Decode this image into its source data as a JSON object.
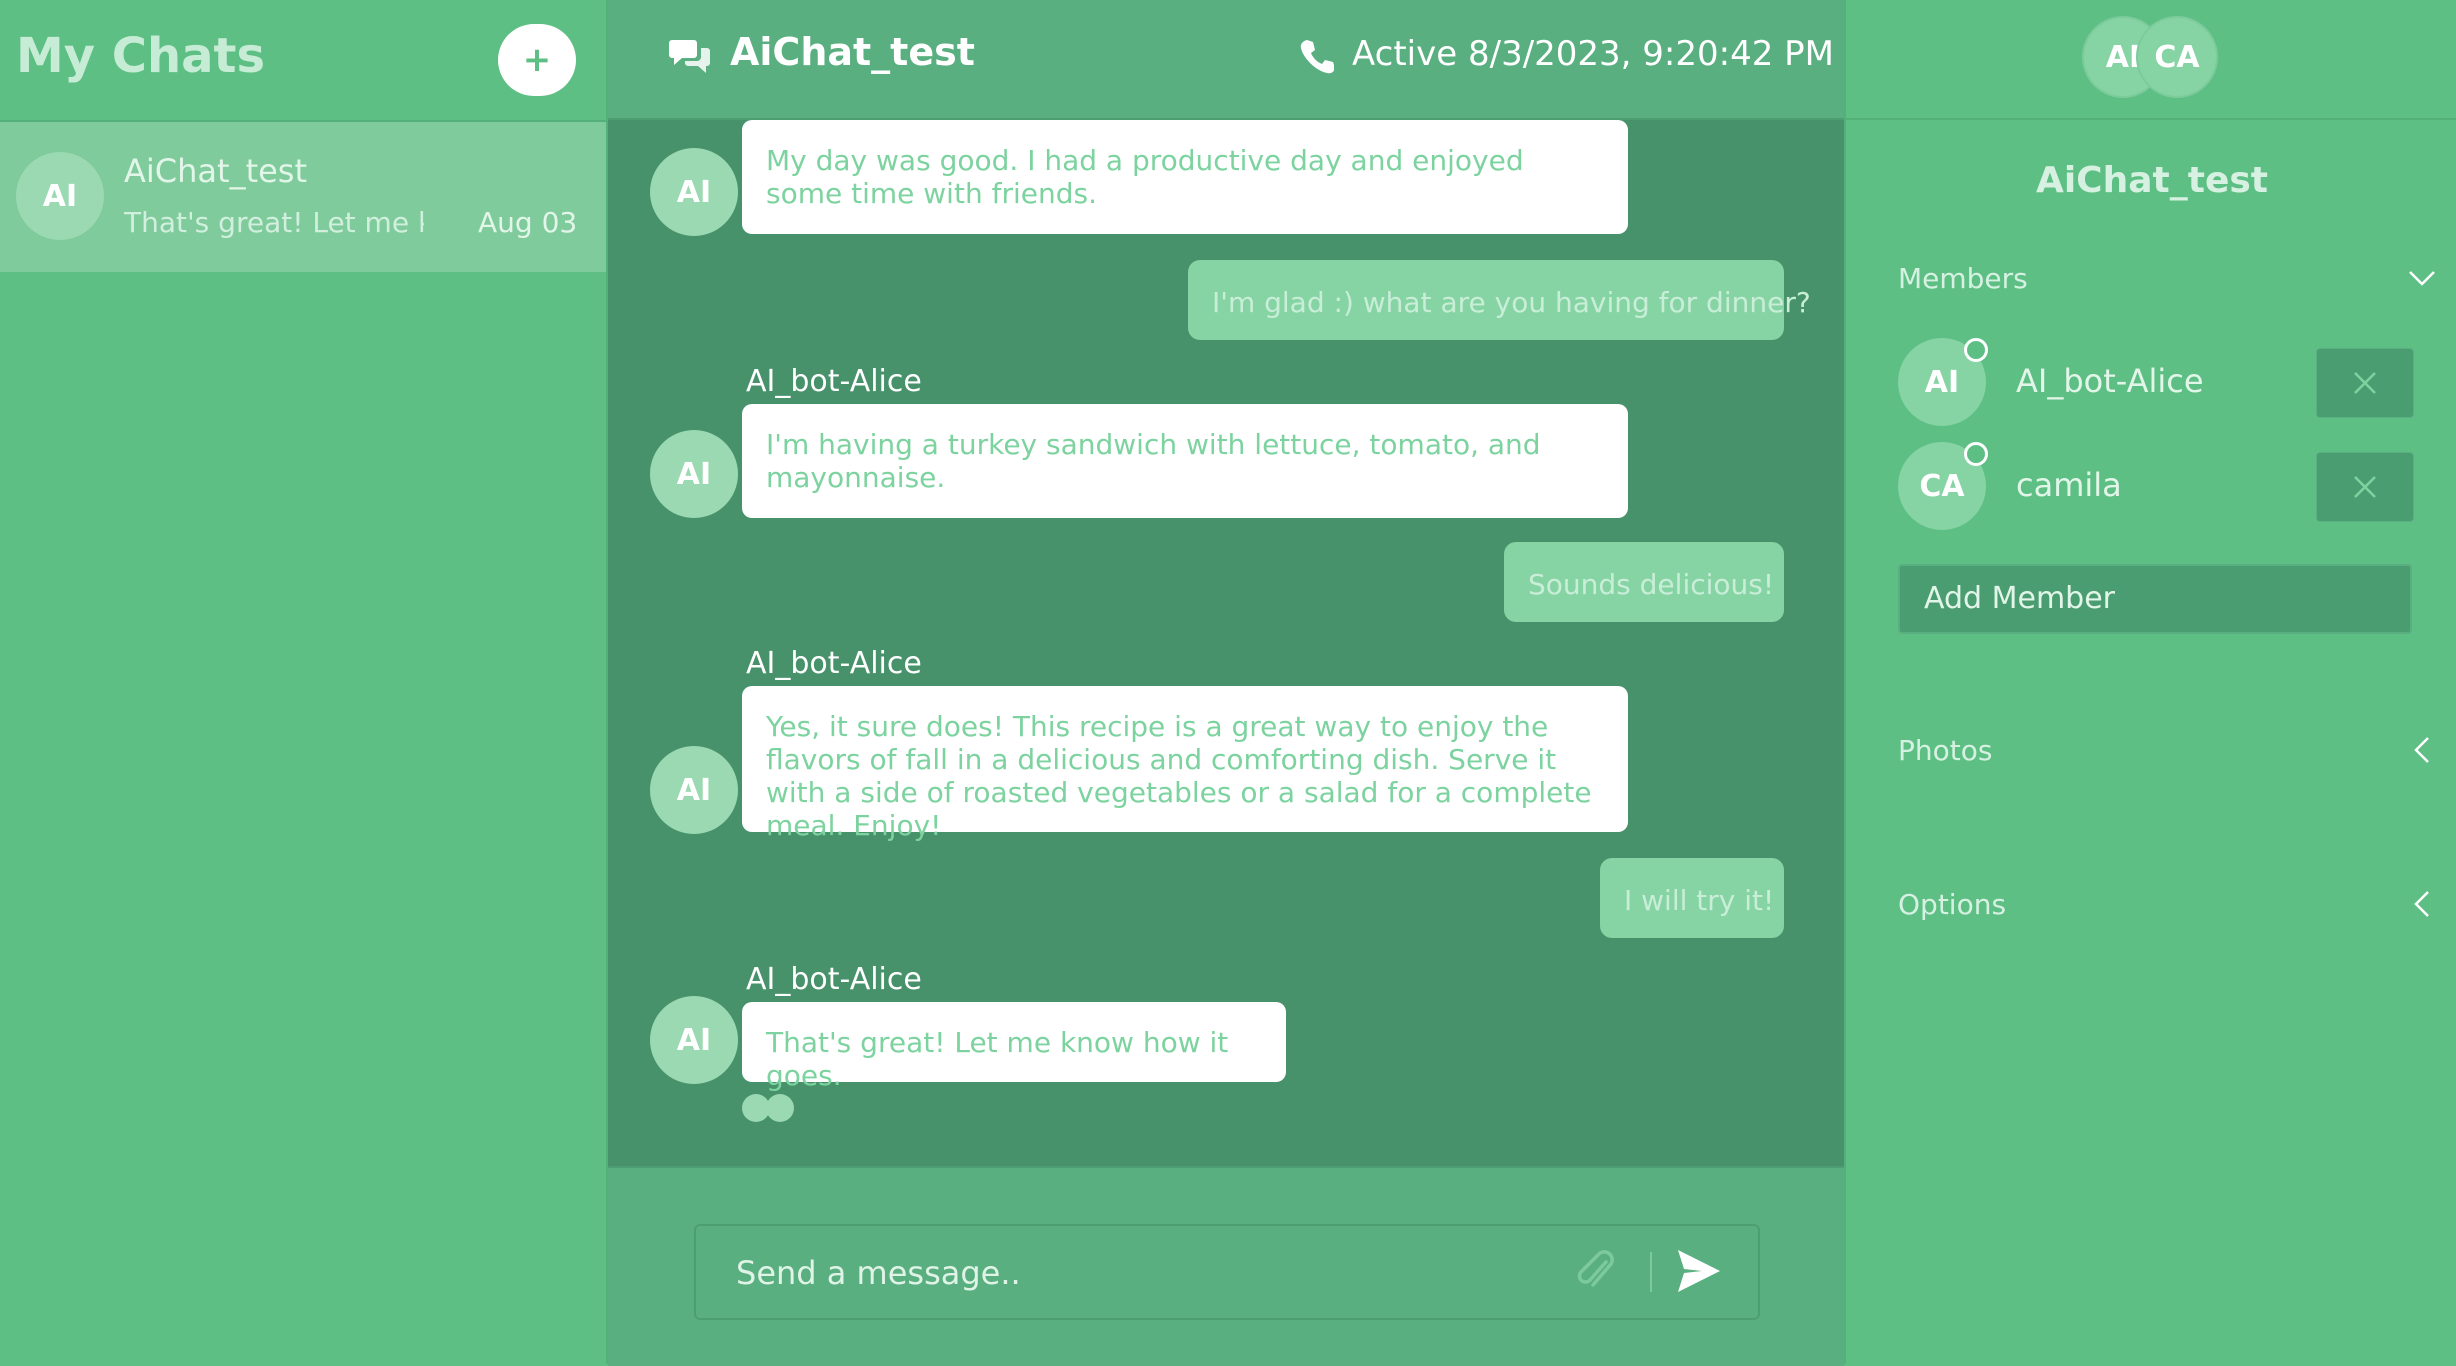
{
  "sidebar": {
    "title": "My Chats",
    "new_chat_label": "+",
    "chats": [
      {
        "avatar": "AI",
        "name": "AiChat_test",
        "preview": "That's great! Let me know how it goes.",
        "date": "Aug 03"
      }
    ]
  },
  "header": {
    "title": "AiChat_test",
    "status": "Active 8/3/2023, 9:20:42 PM",
    "icons": [
      "chat-bubbles-icon",
      "phone-icon"
    ]
  },
  "messages": [
    {
      "direction": "in",
      "avatar": "AI",
      "sender": "",
      "text": "My day was good. I had a productive day and enjoyed some time with friends."
    },
    {
      "direction": "out",
      "text": "I'm glad :) what are you having for dinner?"
    },
    {
      "direction": "in",
      "avatar": "AI",
      "sender": "AI_bot-Alice",
      "text": "I'm having a turkey sandwich with lettuce, tomato, and mayonnaise."
    },
    {
      "direction": "out",
      "text": "Sounds delicious!"
    },
    {
      "direction": "in",
      "avatar": "AI",
      "sender": "AI_bot-Alice",
      "text": "Yes, it sure does! This recipe is a great way to enjoy the flavors of fall in a delicious and comforting dish. Serve it with a side of roasted vegetables or a salad for a complete meal. Enjoy!"
    },
    {
      "direction": "out",
      "text": "I will try it!"
    },
    {
      "direction": "in",
      "avatar": "AI",
      "sender": "AI_bot-Alice",
      "text": "That's great! Let me know how it goes."
    }
  ],
  "composer": {
    "placeholder": "Send a message.."
  },
  "right_panel": {
    "avatars": [
      "AI",
      "CA"
    ],
    "title": "AiChat_test",
    "members_label": "Members",
    "members": [
      {
        "avatar": "AI",
        "name": "AI_bot-Alice"
      },
      {
        "avatar": "CA",
        "name": "camila"
      }
    ],
    "add_member_label": "Add Member",
    "photos_label": "Photos",
    "options_label": "Options"
  },
  "colors": {
    "sidebar_bg": "#5dbf84",
    "chat_bg": "#47926b",
    "header_bg": "#5aaf80",
    "bubble_in": "#ffffff",
    "bubble_out": "#86d3a4",
    "accent_text": "#7dd39f"
  }
}
